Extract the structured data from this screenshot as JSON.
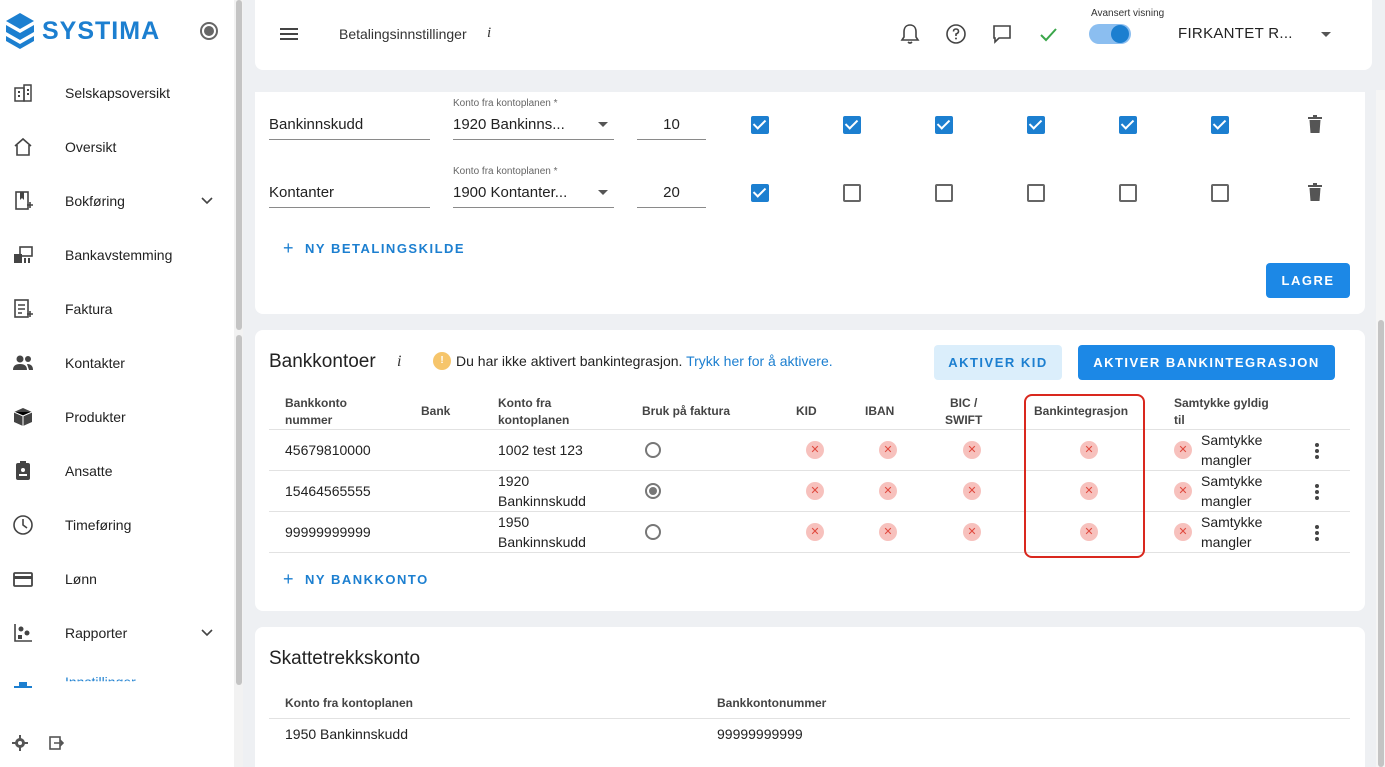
{
  "app": {
    "logo_text": "SYSTIMA"
  },
  "sidebar": {
    "items": [
      {
        "label": "Selskapsoversikt",
        "icon": "building-icon"
      },
      {
        "label": "Oversikt",
        "icon": "home-icon"
      },
      {
        "label": "Bokføring",
        "icon": "ledger-icon",
        "expandable": true
      },
      {
        "label": "Bankavstemming",
        "icon": "bank-reconcile-icon"
      },
      {
        "label": "Faktura",
        "icon": "invoice-icon"
      },
      {
        "label": "Kontakter",
        "icon": "contacts-icon"
      },
      {
        "label": "Produkter",
        "icon": "box-icon"
      },
      {
        "label": "Ansatte",
        "icon": "badge-icon"
      },
      {
        "label": "Timeføring",
        "icon": "clock-icon"
      },
      {
        "label": "Lønn",
        "icon": "card-icon"
      },
      {
        "label": "Rapporter",
        "icon": "report-icon",
        "expandable": true
      },
      {
        "label": "Innstillinger",
        "icon": "settings-icon"
      }
    ]
  },
  "header": {
    "title": "Betalingsinnstillinger",
    "info": "i",
    "toggle_label": "Avansert visning",
    "toggle_on": true,
    "company": "FIRKANTET R..."
  },
  "payment_sources": {
    "select_label": "Konto fra kontoplanen *",
    "rows": [
      {
        "name": "Bankinnskudd",
        "account": "1920 Bankinns...",
        "code": "10",
        "checks": [
          true,
          true,
          true,
          true,
          true,
          true
        ]
      },
      {
        "name": "Kontanter",
        "account": "1900 Kontanter...",
        "code": "20",
        "checks": [
          true,
          false,
          false,
          false,
          false,
          false
        ]
      }
    ],
    "add_label": "NY BETALINGSKILDE",
    "save_label": "LAGRE"
  },
  "bank_accounts": {
    "title": "Bankkontoer",
    "info": "i",
    "warning_icon": "!",
    "warning_text": "Du har ikke aktivert bankintegrasjon.",
    "warning_link": "Trykk her for å aktivere.",
    "btn_kid": "AKTIVER KID",
    "btn_integration": "AKTIVER BANKINTEGRASJON",
    "columns": {
      "account_number": [
        "Bankkonto",
        "nummer"
      ],
      "bank": "Bank",
      "chart_account": [
        "Konto fra",
        "kontoplanen"
      ],
      "use_on_invoice": "Bruk på faktura",
      "kid": "KID",
      "iban": "IBAN",
      "bic": [
        "BIC /",
        "SWIFT"
      ],
      "integration": "Bankintegrasjon",
      "consent": [
        "Samtykke gyldig",
        "til"
      ]
    },
    "rows": [
      {
        "number": "45679810000",
        "bank": "",
        "account": [
          "1002 test 123"
        ],
        "invoice": false,
        "consent": [
          "Samtykke",
          "mangler"
        ]
      },
      {
        "number": "15464565555",
        "bank": "",
        "account": [
          "1920",
          "Bankinnskudd"
        ],
        "invoice": true,
        "consent": [
          "Samtykke",
          "mangler"
        ]
      },
      {
        "number": "99999999999",
        "bank": "",
        "account": [
          "1950",
          "Bankinnskudd"
        ],
        "invoice": false,
        "consent": [
          "Samtykke",
          "mangler"
        ]
      }
    ],
    "add_label": "NY BANKKONTO"
  },
  "tax_account": {
    "title": "Skattetrekkskonto",
    "col_account": "Konto fra kontoplanen",
    "col_number": "Bankkontonummer",
    "row": {
      "account": "1950 Bankinnskudd",
      "number": "99999999999"
    }
  },
  "colors": {
    "accent": "#1c88e6",
    "brand": "#1c7fd0",
    "error_soft": "#f7c1bd",
    "highlight": "#d9281e"
  }
}
